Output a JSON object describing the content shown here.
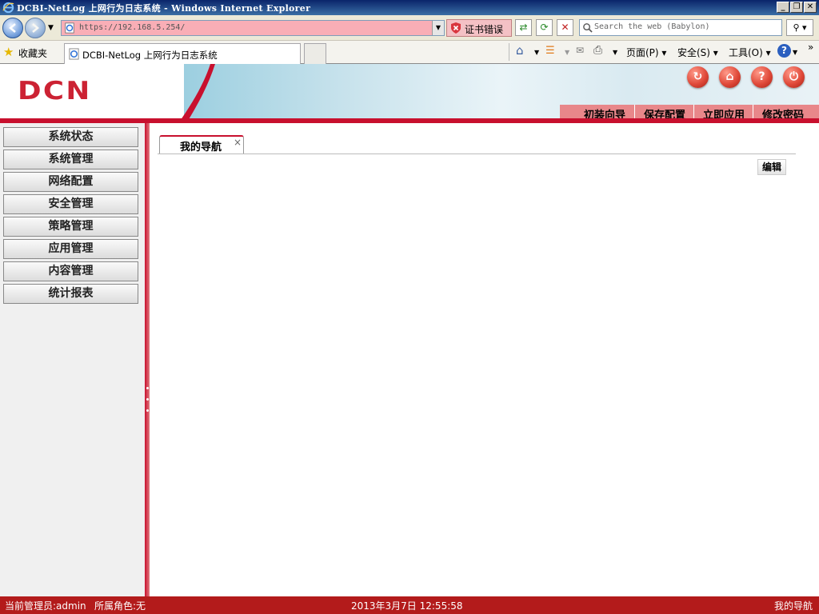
{
  "window": {
    "title": "DCBI-NetLog 上网行为日志系统 - Windows Internet Explorer",
    "controls": [
      "_",
      "❐",
      "✕"
    ]
  },
  "browser": {
    "url": "https://192.168.5.254/",
    "cert_error": "证书错误",
    "search_placeholder": "Search the web (Babylon)",
    "favorites_label": "收藏夹",
    "tab_title": "DCBI-NetLog 上网行为日志系统",
    "commands": {
      "page": "页面(P)",
      "safety": "安全(S)",
      "tools": "工具(O)"
    }
  },
  "header": {
    "logo": "DCN",
    "icons": [
      "refresh-icon",
      "home-icon",
      "help-icon",
      "logout-icon"
    ],
    "links": [
      "初装向导",
      "保存配置",
      "立即应用",
      "修改密码"
    ]
  },
  "sidebar": {
    "items": [
      {
        "label": "系统状态"
      },
      {
        "label": "系统管理"
      },
      {
        "label": "网络配置"
      },
      {
        "label": "安全管理"
      },
      {
        "label": "策略管理"
      },
      {
        "label": "应用管理"
      },
      {
        "label": "内容管理"
      },
      {
        "label": "统计报表"
      }
    ]
  },
  "content": {
    "tab_label": "我的导航",
    "tab_close": "×",
    "edit_label": "编辑"
  },
  "status": {
    "admin": "当前管理员:admin",
    "role": "所属角色:无",
    "datetime": "2013年3月7日 12:55:58",
    "location": "我的导航"
  },
  "colors": {
    "brand_red": "#c8102e",
    "status_bar": "#b31b1b",
    "address_error": "#f9aeb6"
  }
}
